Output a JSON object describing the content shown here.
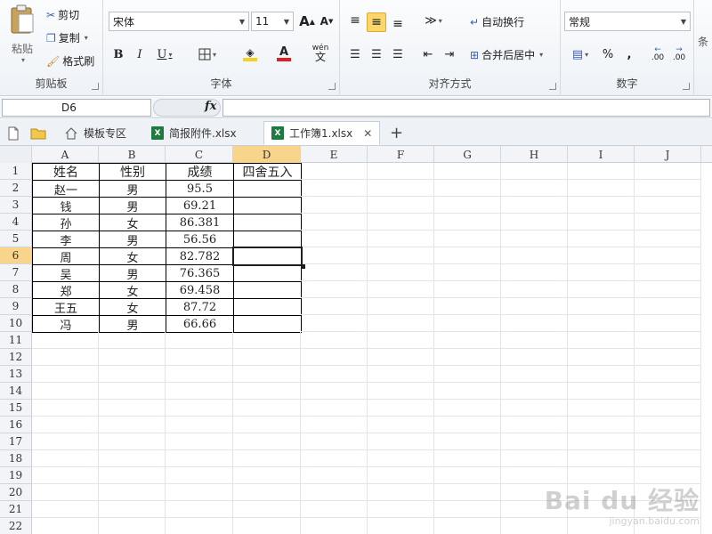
{
  "ribbon": {
    "clipboard": {
      "paste": "粘贴",
      "cut": "剪切",
      "copy": "复制",
      "format_painter": "格式刷",
      "label": "剪贴板"
    },
    "font": {
      "name": "宋体",
      "size": "11",
      "grow": "A",
      "shrink": "A",
      "bold": "B",
      "italic": "I",
      "underline": "U",
      "wen": "wén",
      "wen_char": "文",
      "label": "字体",
      "fill_color": "#f6d21e",
      "font_color": "#e02020"
    },
    "alignment": {
      "wrap_text": "自动换行",
      "merge_center": "合并后居中",
      "label": "对齐方式"
    },
    "number": {
      "format": "常规",
      "percent": "%",
      "comma": ",",
      "inc_dec": ".00",
      "dec_dec": ".00",
      "label": "数字"
    },
    "cut_off": "条"
  },
  "formula_bar": {
    "name_box": "D6",
    "fx": "fx",
    "value": ""
  },
  "tabs": {
    "template": "模板专区",
    "file1": "简报附件.xlsx",
    "file2": "工作簿1.xlsx",
    "xl": "X",
    "add": "+",
    "close": "✕"
  },
  "sheet": {
    "columns": [
      "A",
      "B",
      "C",
      "D",
      "E",
      "F",
      "G",
      "H",
      "I",
      "J"
    ],
    "rows": [
      "1",
      "2",
      "3",
      "4",
      "5",
      "6",
      "7",
      "8",
      "9",
      "10",
      "11",
      "12",
      "13",
      "14",
      "15",
      "16",
      "17",
      "18",
      "19",
      "20",
      "21",
      "22"
    ],
    "selected_cell": "D6",
    "header": [
      "姓名",
      "性别",
      "成绩",
      "四舍五入"
    ],
    "data": [
      [
        "赵一",
        "男",
        "95.5",
        ""
      ],
      [
        "钱",
        "男",
        "69.21",
        ""
      ],
      [
        "孙",
        "女",
        "86.381",
        ""
      ],
      [
        "李",
        "男",
        "56.56",
        ""
      ],
      [
        "周",
        "女",
        "82.782",
        ""
      ],
      [
        "吴",
        "男",
        "76.365",
        ""
      ],
      [
        "郑",
        "女",
        "69.458",
        ""
      ],
      [
        "王五",
        "女",
        "87.72",
        ""
      ],
      [
        "冯",
        "男",
        "66.66",
        ""
      ]
    ]
  },
  "watermark": {
    "logo": "Bai du 经验",
    "sub": "jingyan.baidu.com"
  }
}
